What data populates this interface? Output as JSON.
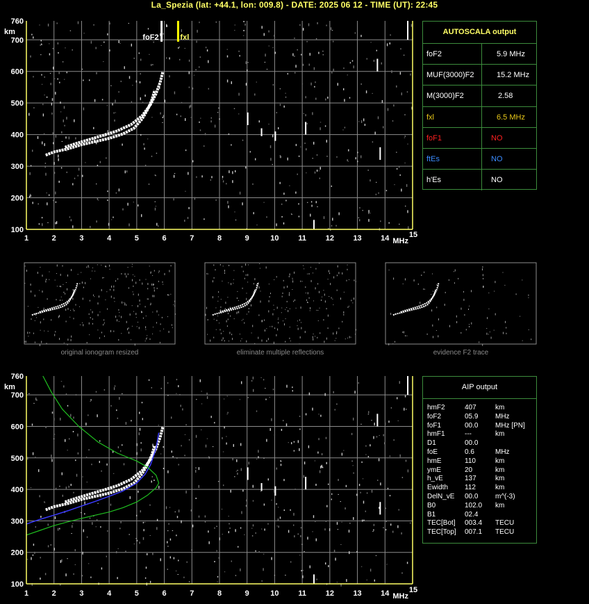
{
  "header": {
    "title": "La_Spezia (lat: +44.1, lon: 009.8) - DATE: 2025 06 12 - TIME (UT): 22:45"
  },
  "colors": {
    "axis": "#ffff66",
    "grid": "#8c8c8c",
    "table_border": "#3c8c3c",
    "fof2_marker": "#ffffff",
    "fxl_marker": "#ffff00",
    "profile_curve": "#20c020",
    "fit_curve": "#3a3aff"
  },
  "chart_data": [
    {
      "type": "scatter",
      "title": "",
      "xlabel": "MHz",
      "ylabel": "km",
      "xlim": [
        1,
        15
      ],
      "ylim": [
        100,
        760
      ],
      "x_ticks": [
        "1",
        "2",
        "3",
        "4",
        "5",
        "6",
        "7",
        "8",
        "9",
        "10",
        "11",
        "12",
        "13",
        "14",
        "15"
      ],
      "y_ticks": [
        "100",
        "200",
        "300",
        "400",
        "500",
        "600",
        "700",
        "760"
      ],
      "grid": true,
      "markers": [
        {
          "label": "foF2",
          "x": 5.9
        },
        {
          "label": "fxl",
          "x": 6.5
        }
      ],
      "series": [
        {
          "x": [
            1.7,
            2.0,
            2.5,
            3.0,
            3.5,
            4.0,
            4.5,
            4.9,
            5.2,
            5.4,
            5.55,
            5.65
          ],
          "y": [
            335,
            345,
            355,
            368,
            378,
            388,
            402,
            420,
            450,
            480,
            510,
            540
          ]
        },
        {
          "x": [
            2.4,
            2.8,
            3.3,
            3.8,
            4.3,
            4.8,
            5.2,
            5.5,
            5.7,
            5.85,
            5.95
          ],
          "y": [
            360,
            372,
            385,
            398,
            412,
            432,
            460,
            495,
            530,
            565,
            600
          ]
        }
      ]
    },
    {
      "type": "scatter",
      "title": "",
      "xlabel": "MHz",
      "ylabel": "km",
      "xlim": [
        1,
        15
      ],
      "ylim": [
        100,
        760
      ],
      "x_ticks": [
        "1",
        "2",
        "3",
        "4",
        "5",
        "6",
        "7",
        "8",
        "9",
        "10",
        "11",
        "12",
        "13",
        "14",
        "15"
      ],
      "y_ticks": [
        "100",
        "200",
        "300",
        "400",
        "500",
        "600",
        "700",
        "760"
      ],
      "grid": true,
      "series": [
        {
          "x": [
            1.7,
            2.0,
            2.5,
            3.0,
            3.5,
            4.0,
            4.5,
            4.9,
            5.2,
            5.4,
            5.55,
            5.65
          ],
          "y": [
            335,
            345,
            355,
            368,
            378,
            388,
            402,
            420,
            450,
            480,
            510,
            540
          ]
        },
        {
          "x": [
            2.4,
            2.8,
            3.3,
            3.8,
            4.3,
            4.8,
            5.2,
            5.5,
            5.7,
            5.85,
            5.95
          ],
          "y": [
            360,
            372,
            385,
            398,
            412,
            432,
            460,
            495,
            530,
            565,
            600
          ]
        },
        {
          "x": [
            1.0,
            1.5,
            2.0,
            2.5,
            3.0,
            3.5,
            4.0,
            4.5,
            5.0,
            5.3,
            5.5,
            5.7,
            5.8
          ],
          "y": [
            290,
            305,
            318,
            332,
            347,
            362,
            378,
            395,
            420,
            448,
            478,
            530,
            580
          ]
        },
        {
          "x": [
            1.0,
            1.5,
            2.0,
            2.5,
            3.0,
            3.5,
            4.0,
            4.5,
            5.0,
            5.4,
            5.7,
            5.8,
            5.7,
            5.4,
            5.0,
            4.3,
            3.6,
            2.9,
            2.3,
            1.9,
            1.6
          ],
          "y": [
            255,
            270,
            285,
            297,
            308,
            318,
            328,
            342,
            360,
            382,
            405,
            420,
            445,
            470,
            490,
            515,
            550,
            600,
            655,
            710,
            760
          ]
        }
      ]
    }
  ],
  "autoscala": {
    "title": "AUTOSCALA output",
    "rows": [
      {
        "label": "foF2",
        "value": "5.9 MHz",
        "color": "#ffffff"
      },
      {
        "label": "MUF(3000)F2",
        "value": "15.2 MHz",
        "color": "#ffffff"
      },
      {
        "label": "M(3000)F2",
        "value": "2.58",
        "color": "#ffffff"
      },
      {
        "label": "fxl",
        "value": "6.5 MHz",
        "color": "#e6c619"
      },
      {
        "label": "foF1",
        "value": "NO",
        "color": "#ff2020"
      },
      {
        "label": "ftEs",
        "value": "NO",
        "color": "#3a8cff"
      },
      {
        "label": "h'Es",
        "value": "NO",
        "color": "#ffffff"
      }
    ]
  },
  "thumbnails": [
    {
      "caption": "original ionogram resized"
    },
    {
      "caption": "eliminate multiple reflections"
    },
    {
      "caption": "evidence F2 trace"
    }
  ],
  "aip": {
    "title": "AIP output",
    "rows": [
      {
        "label": "hmF2",
        "value": "407",
        "unit": "km"
      },
      {
        "label": "foF2",
        "value": "05.9",
        "unit": "MHz"
      },
      {
        "label": "foF1",
        "value": "00.0",
        "unit": "MHz   [PN]"
      },
      {
        "label": "hmF1",
        "value": "---",
        "unit": "km"
      },
      {
        "label": "D1",
        "value": "00.0",
        "unit": ""
      },
      {
        "label": "foE",
        "value": "0.6",
        "unit": "MHz"
      },
      {
        "label": "hmE",
        "value": "110",
        "unit": "km"
      },
      {
        "label": "ymE",
        "value": "20",
        "unit": "km"
      },
      {
        "label": "h_vE",
        "value": "137",
        "unit": "km"
      },
      {
        "label": "Ewidth",
        "value": "112",
        "unit": "km"
      },
      {
        "label": "DelN_vE",
        "value": "00.0",
        "unit": "m^(-3)"
      },
      {
        "label": "B0",
        "value": "102.0",
        "unit": "km"
      },
      {
        "label": "B1",
        "value": "02.4",
        "unit": ""
      },
      {
        "label": "TEC[Bot]",
        "value": "003.4",
        "unit": "TECU"
      },
      {
        "label": "TEC[Top]",
        "value": "007.1",
        "unit": "TECU"
      }
    ]
  }
}
